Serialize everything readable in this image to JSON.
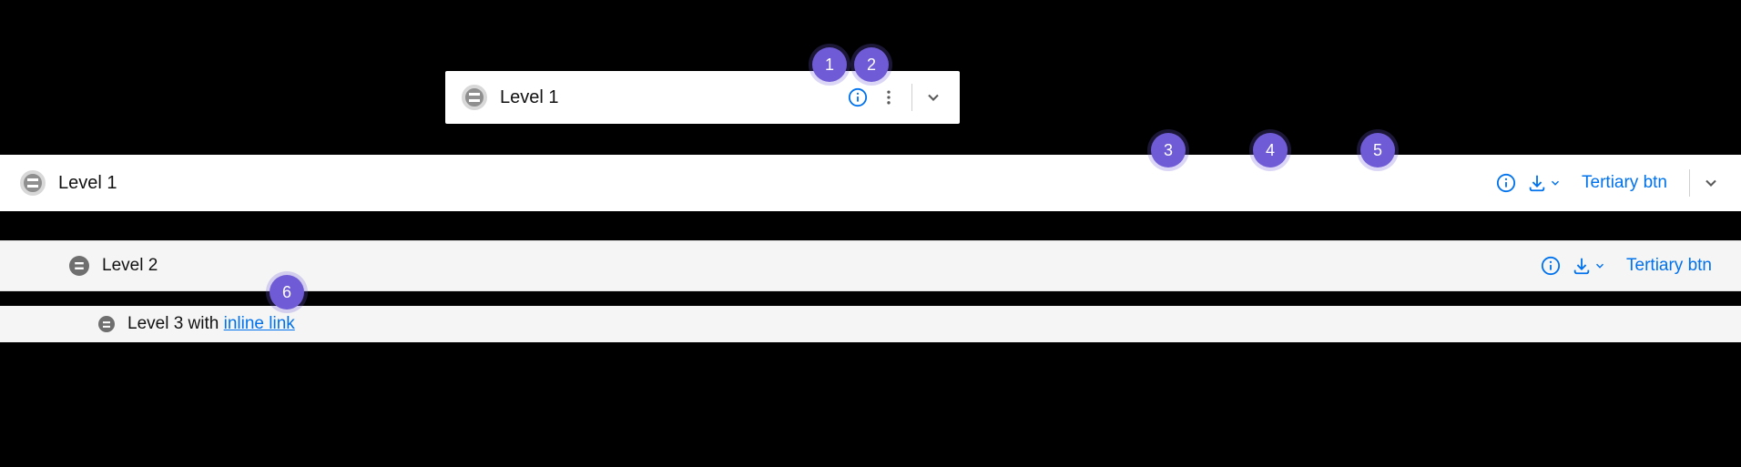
{
  "floating": {
    "label": "Level 1"
  },
  "row1": {
    "label": "Level 1",
    "tertiary": "Tertiary btn"
  },
  "row2": {
    "label": "Level 2",
    "tertiary": "Tertiary btn"
  },
  "row3": {
    "label_prefix": "Level 3 with ",
    "link_text": "inline link"
  },
  "annotations": {
    "b1": "1",
    "b2": "2",
    "b3": "3",
    "b4": "4",
    "b5": "5",
    "b6": "6"
  }
}
